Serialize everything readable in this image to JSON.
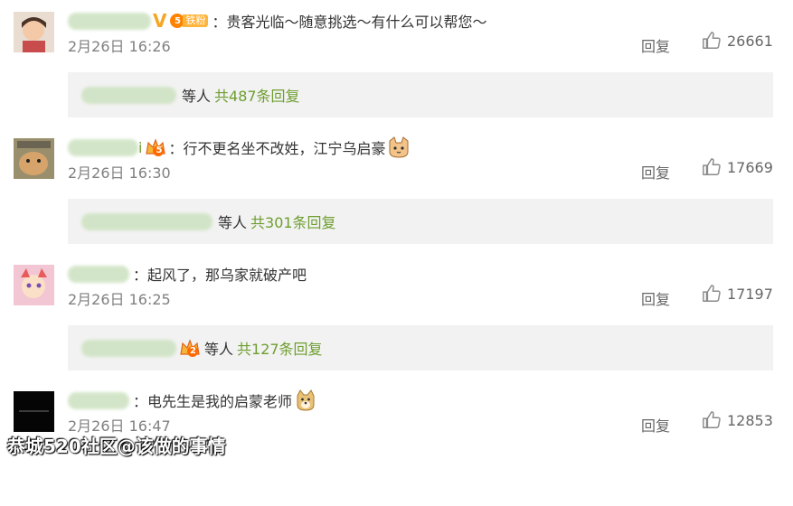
{
  "comments": [
    {
      "avatar": "avatar-girl",
      "vip_mark": "V",
      "fan_level": "5",
      "fan_label": "铁粉",
      "colon": "：",
      "text": "贵客光临～随意挑选～有什么可以帮您～",
      "emoji": "",
      "time": "2月26日 16:26",
      "reply_label": "回复",
      "likes": "26661",
      "replies_etc": "等人",
      "replies_total": "共487条回复"
    },
    {
      "avatar": "avatar-hamster",
      "name_tail": "i",
      "crown_level": "5",
      "colon": "：",
      "text": "行不更名坐不改姓，江宁乌启豪",
      "emoji": "cat-emoji",
      "time": "2月26日 16:30",
      "reply_label": "回复",
      "likes": "17669",
      "replies_etc": "等人",
      "replies_total": "共301条回复"
    },
    {
      "avatar": "avatar-cartoon",
      "colon": "：",
      "text": "起风了，那乌家就破产吧",
      "emoji": "",
      "time": "2月26日 16:25",
      "reply_label": "回复",
      "likes": "17197",
      "replies_crown_level": "2",
      "replies_etc": "等人",
      "replies_total": "共127条回复"
    },
    {
      "avatar": "avatar-black",
      "colon": "：",
      "text": "电先生是我的启蒙老师",
      "emoji": "doge-emoji",
      "time": "2月26日 16:47",
      "reply_label": "回复",
      "likes": "12853"
    }
  ],
  "watermark": "恭城520社区@该做的事情",
  "colors": {
    "green_link": "#6e9e2f",
    "reply_bg": "#f2f2f2",
    "meta_gray": "#808080"
  }
}
